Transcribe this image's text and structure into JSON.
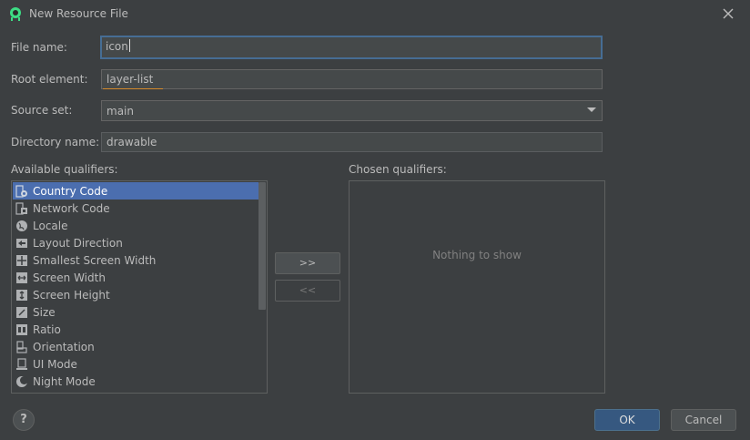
{
  "window": {
    "title": "New Resource File"
  },
  "form": {
    "file_name_label": "File name:",
    "file_name_value": "icon",
    "root_element_label": "Root element:",
    "root_element_value": "layer-list",
    "source_set_label": "Source set:",
    "source_set_value": "main",
    "directory_name_label": "Directory name:",
    "directory_name_value": "drawable"
  },
  "qualifiers": {
    "available_label": "Available qualifiers:",
    "chosen_label": "Chosen qualifiers:",
    "empty_text": "Nothing to show",
    "add_label": ">>",
    "remove_label": "<<",
    "items": [
      {
        "label": "Country Code",
        "icon": "country-code-icon"
      },
      {
        "label": "Network Code",
        "icon": "network-code-icon"
      },
      {
        "label": "Locale",
        "icon": "globe-icon"
      },
      {
        "label": "Layout Direction",
        "icon": "layout-direction-icon"
      },
      {
        "label": "Smallest Screen Width",
        "icon": "smallest-width-icon"
      },
      {
        "label": "Screen Width",
        "icon": "screen-width-icon"
      },
      {
        "label": "Screen Height",
        "icon": "screen-height-icon"
      },
      {
        "label": "Size",
        "icon": "size-icon"
      },
      {
        "label": "Ratio",
        "icon": "ratio-icon"
      },
      {
        "label": "Orientation",
        "icon": "orientation-icon"
      },
      {
        "label": "UI Mode",
        "icon": "ui-mode-icon"
      },
      {
        "label": "Night Mode",
        "icon": "night-mode-icon"
      }
    ]
  },
  "footer": {
    "help_label": "?",
    "ok_label": "OK",
    "cancel_label": "Cancel"
  },
  "colors": {
    "background": "#3c3f41",
    "selection": "#4b6eaf",
    "focus_border": "#466d94",
    "accent_underline": "#d68a2b",
    "primary_button": "#365880"
  }
}
